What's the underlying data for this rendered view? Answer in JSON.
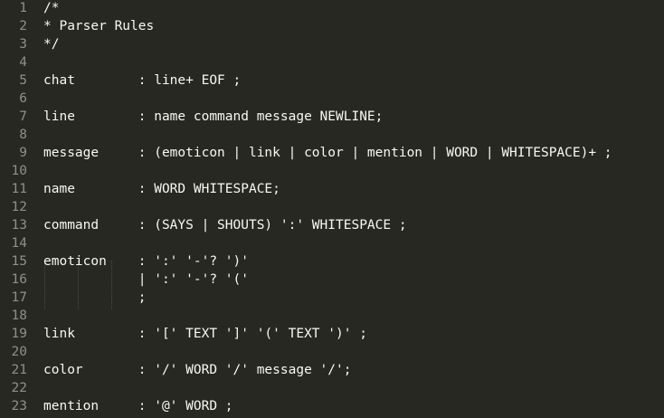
{
  "editor": {
    "theme_colors": {
      "background": "#272822",
      "text": "#f8f8f2",
      "line_number": "#8f908a",
      "indent_guide": "#4a4b44"
    },
    "lines": [
      {
        "number": "1",
        "text": "/*"
      },
      {
        "number": "2",
        "text": "* Parser Rules"
      },
      {
        "number": "3",
        "text": "*/"
      },
      {
        "number": "4",
        "text": ""
      },
      {
        "number": "5",
        "text": "chat        : line+ EOF ;"
      },
      {
        "number": "6",
        "text": ""
      },
      {
        "number": "7",
        "text": "line        : name command message NEWLINE;"
      },
      {
        "number": "8",
        "text": ""
      },
      {
        "number": "9",
        "text": "message     : (emoticon | link | color | mention | WORD | WHITESPACE)+ ;"
      },
      {
        "number": "10",
        "text": ""
      },
      {
        "number": "11",
        "text": "name        : WORD WHITESPACE;"
      },
      {
        "number": "12",
        "text": ""
      },
      {
        "number": "13",
        "text": "command     : (SAYS | SHOUTS) ':' WHITESPACE ;"
      },
      {
        "number": "14",
        "text": ""
      },
      {
        "number": "15",
        "text": "emoticon    : ':' '-'? ')'"
      },
      {
        "number": "16",
        "text": "            | ':' '-'? '('"
      },
      {
        "number": "17",
        "text": "            ;"
      },
      {
        "number": "18",
        "text": ""
      },
      {
        "number": "19",
        "text": "link        : '[' TEXT ']' '(' TEXT ')' ;"
      },
      {
        "number": "20",
        "text": ""
      },
      {
        "number": "21",
        "text": "color       : '/' WORD '/' message '/';"
      },
      {
        "number": "22",
        "text": ""
      },
      {
        "number": "23",
        "text": "mention     : '@' WORD ;"
      }
    ]
  }
}
